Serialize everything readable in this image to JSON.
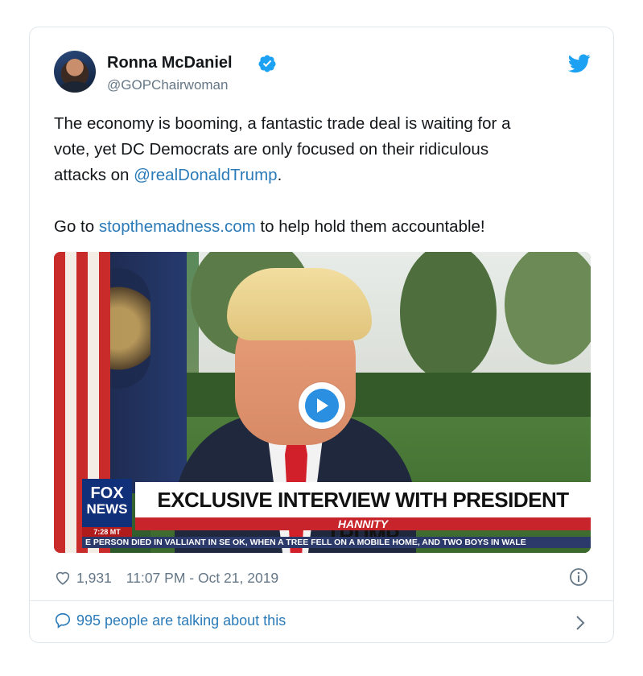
{
  "author": {
    "name": "Ronna McDaniel",
    "handle": "@GOPChairwoman",
    "verified": true
  },
  "tweet": {
    "text_line1": "The economy is booming, a fantastic trade deal is waiting for a",
    "text_line2": "vote, yet DC Democrats are only focused on their ridiculous",
    "text_line3_prefix": "attacks on ",
    "mention": "@realDonaldTrump",
    "text_line3_suffix": ".",
    "text_p2_prefix": "Go to ",
    "link": "stopthemadness.com",
    "text_p2_suffix": " to help hold them accountable!"
  },
  "media": {
    "type": "video",
    "broadcast": {
      "logo_line1": "FOX",
      "logo_line2": "NEWS",
      "time": "7:28 MT",
      "headline": "EXCLUSIVE INTERVIEW WITH PRESIDENT TRUMP",
      "show": "HANNITY",
      "ticker": "E PERSON DIED IN VALLIANT IN SE OK, WHEN A TREE FELL ON A MOBILE HOME, AND TWO BOYS IN WALE"
    }
  },
  "stats": {
    "likes": "1,931",
    "timestamp": "11:07 PM - Oct 21, 2019"
  },
  "footer": {
    "talking": "995 people are talking about this"
  },
  "icons": {
    "verified": "verified-badge-icon",
    "bird": "twitter-bird-icon",
    "play": "play-icon",
    "heart": "heart-icon",
    "info": "info-icon",
    "bubble": "comment-bubble-icon",
    "chevron": "chevron-right-icon"
  },
  "colors": {
    "link": "#2b7bb9",
    "brand": "#1da1f2",
    "muted": "#657786"
  }
}
